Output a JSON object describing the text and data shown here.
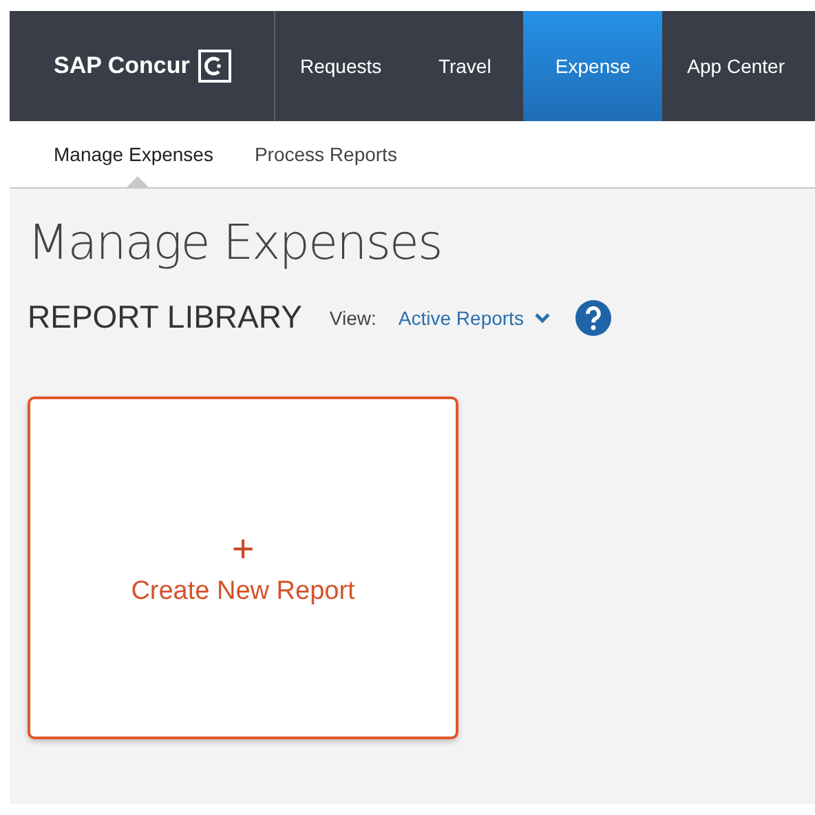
{
  "brand": {
    "name": "SAP Concur"
  },
  "nav_tabs": [
    {
      "label": "Requests",
      "selected": false
    },
    {
      "label": "Travel",
      "selected": false
    },
    {
      "label": "Expense",
      "selected": true
    },
    {
      "label": "App Center",
      "selected": false
    }
  ],
  "sub_tabs": [
    {
      "label": "Manage Expenses",
      "selected": true
    },
    {
      "label": "Process Reports",
      "selected": false
    }
  ],
  "page_title": "Manage Expenses",
  "section": {
    "title": "REPORT LIBRARY",
    "view_label": "View:",
    "view_value": "Active Reports"
  },
  "create_card": {
    "symbol": "+",
    "label": "Create New Report"
  }
}
